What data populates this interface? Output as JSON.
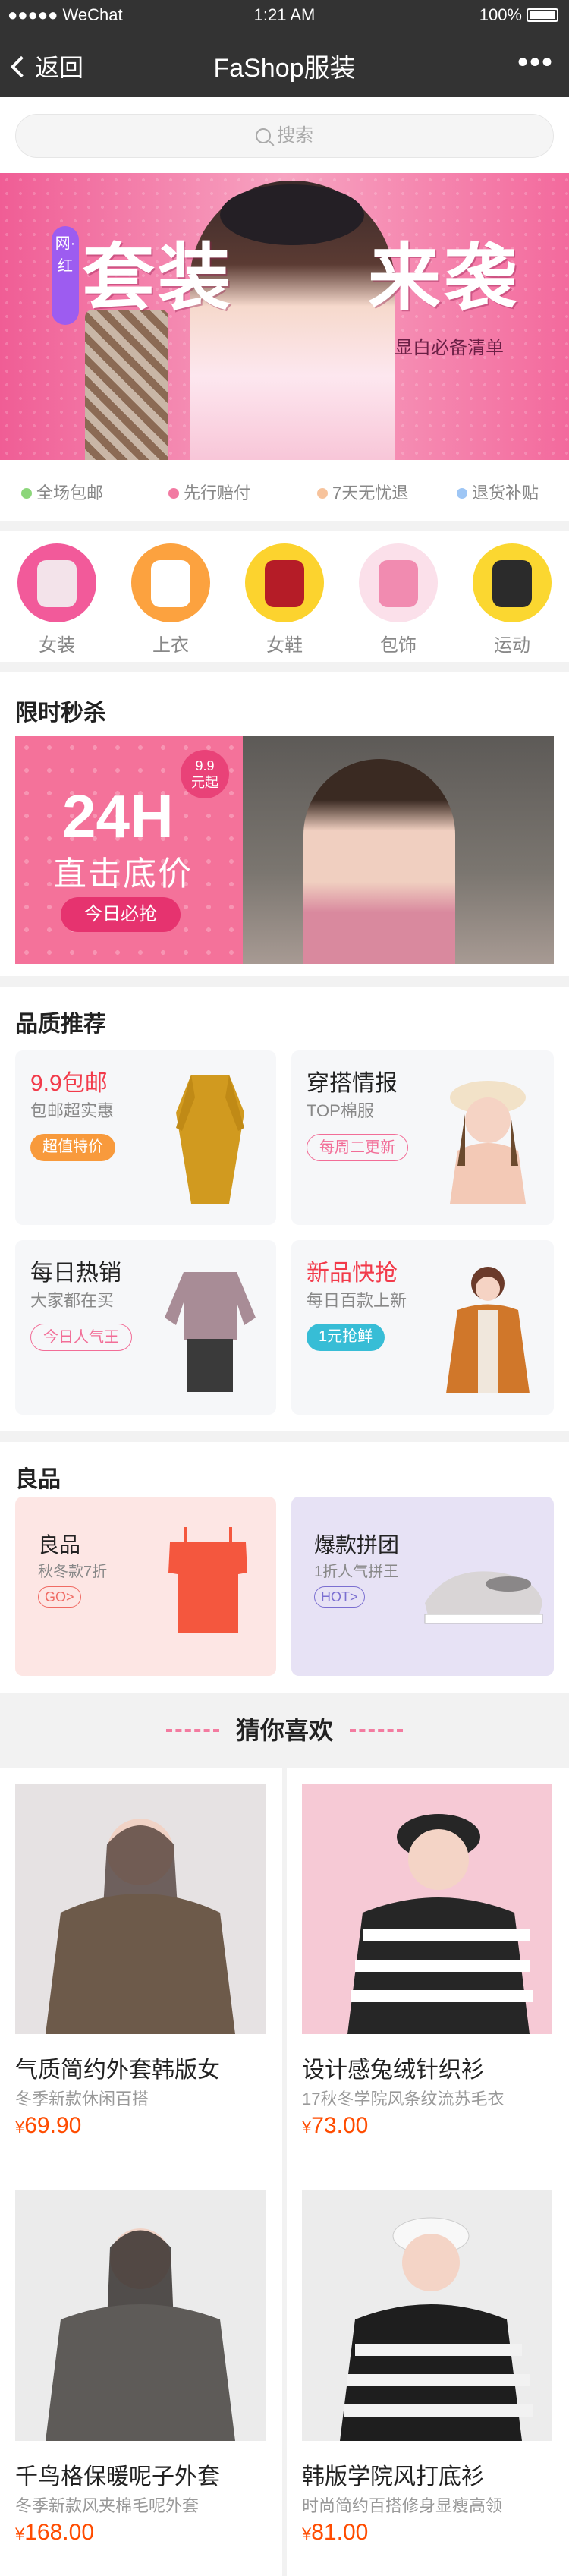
{
  "status_bar": {
    "carrier": "●●●●● WeChat",
    "time": "1:21 AM",
    "battery": "100%"
  },
  "nav": {
    "back_label": "返回",
    "title": "FaShop服装",
    "more": "•••"
  },
  "search": {
    "placeholder": "搜索"
  },
  "banner": {
    "tag": "网·红",
    "title_left": "套装",
    "title_right": "来袭",
    "subtitle": "显白必备清单"
  },
  "services": [
    {
      "label": "全场包邮",
      "color": "#8cd67a"
    },
    {
      "label": "先行赔付",
      "color": "#f27aa2"
    },
    {
      "label": "7天无忧退",
      "color": "#f7c39c"
    },
    {
      "label": "退货补贴",
      "color": "#9ec6f5"
    }
  ],
  "categories": [
    {
      "label": "女装",
      "icon": "jacket-icon",
      "bg": "#f25a9a",
      "item": "#f3e3ea"
    },
    {
      "label": "上衣",
      "icon": "shirt-icon",
      "bg": "#fca23f",
      "item": "#ffffff"
    },
    {
      "label": "女鞋",
      "icon": "boots-icon",
      "bg": "#fcd32e",
      "item": "#b51c27"
    },
    {
      "label": "包饰",
      "icon": "handbag-icon",
      "bg": "#fbe0ea",
      "item": "#f18bb0"
    },
    {
      "label": "运动",
      "icon": "sneaker-icon",
      "bg": "#fbd730",
      "item": "#2b2b2b"
    }
  ],
  "flash_sale": {
    "title": "限时秒杀",
    "big": "24H",
    "slogan": "直击底价",
    "button": "今日必抢",
    "badge_price": "9.9",
    "badge_unit": "元起"
  },
  "quality": {
    "title": "品质推荐",
    "tiles": [
      {
        "title": "9.9包邮",
        "sub": "包邮超实惠",
        "badge": "超值特价",
        "title_color": "#f23a4a",
        "badge_style": "solid-orange",
        "icon": "dress-icon"
      },
      {
        "title": "穿搭情报",
        "sub": "TOP棉服",
        "badge": "每周二更新",
        "title_color": "#222222",
        "badge_style": "outline-pink",
        "icon": "model-girl-icon"
      },
      {
        "title": "每日热销",
        "sub": "大家都在买",
        "badge": "今日人气王",
        "title_color": "#222222",
        "badge_style": "outline-pink",
        "icon": "sweater-icon"
      },
      {
        "title": "新品快抢",
        "sub": "每日百款上新",
        "badge": "1元抢鲜",
        "title_color": "#f23a4a",
        "badge_style": "solid-teal",
        "icon": "model-coat-icon"
      }
    ]
  },
  "goods": {
    "title": "良品",
    "items": [
      {
        "title": "良品",
        "sub": "秋冬款7折",
        "badge": "GO>",
        "bg": "#fde6e4",
        "accent": "#f06b64",
        "icon": "offshoulder-top-icon"
      },
      {
        "title": "爆款拼团",
        "sub": "1折人气拼王",
        "badge": "HOT>",
        "bg": "#e7e2f5",
        "accent": "#7b6fd1",
        "icon": "slipon-shoe-icon"
      }
    ]
  },
  "guess": {
    "title": "猜你喜欢"
  },
  "products": [
    {
      "name": "气质简约外套韩版女",
      "desc": "冬季新款休闲百搭",
      "currency": "¥",
      "price": "69.90",
      "img_bg": "#e6e2e3",
      "img_fg": "#6d5a4a"
    },
    {
      "name": "设计感兔绒针织衫",
      "desc": "17秋冬学院风条纹流苏毛衣",
      "currency": "¥",
      "price": "73.00",
      "img_bg": "#f6c9d5",
      "img_fg": "#262626"
    },
    {
      "name": "千鸟格保暖呢子外套",
      "desc": "冬季新款风夹棉毛呢外套",
      "currency": "¥",
      "price": "168.00",
      "img_bg": "#ebebeb",
      "img_fg": "#5e5b58"
    },
    {
      "name": "韩版学院风打底衫",
      "desc": "时尚简约百搭修身显瘦高领",
      "currency": "¥",
      "price": "81.00",
      "img_bg": "#ececec",
      "img_fg": "#1e1e1e"
    }
  ]
}
